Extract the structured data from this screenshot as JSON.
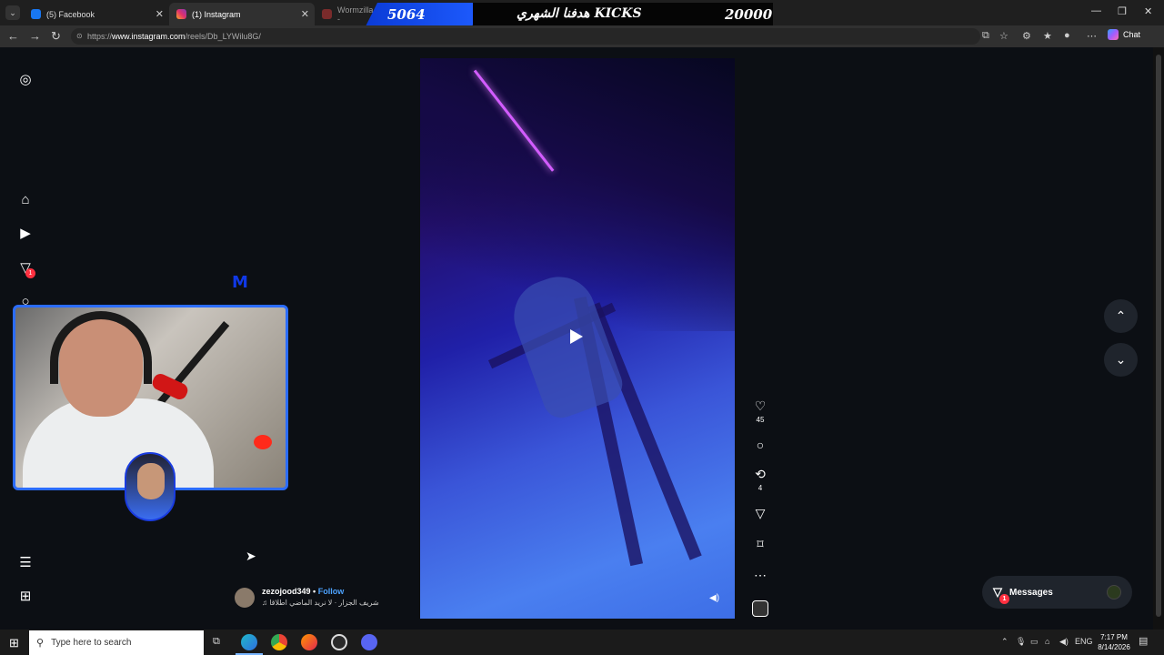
{
  "browser": {
    "tabs": [
      {
        "label": "(5) Facebook",
        "favicon": "facebook-icon",
        "color": "#1877f2"
      },
      {
        "label": "(1) Instagram",
        "favicon": "instagram-icon",
        "color": "#e1306c",
        "active": true
      },
      {
        "label": "Wormzilla.io -",
        "favicon": "wormzilla-icon",
        "color": "#7a2b2b"
      }
    ],
    "url_prefix": "https://",
    "url_host": "www.instagram.com",
    "url_path": "/reels/Db_LYWilu8G/",
    "chat_label": "Chat"
  },
  "stream_overlay": {
    "left_number": "5064",
    "title": "هدفنا الشهري KICKS",
    "right_number": "20000",
    "logo_letter": "M"
  },
  "sidebar": {
    "items": [
      {
        "name": "instagram-logo-icon",
        "glyph": "◎"
      },
      {
        "name": "home-icon",
        "glyph": "⌂"
      },
      {
        "name": "reels-icon",
        "glyph": "▶"
      },
      {
        "name": "direct-icon",
        "glyph": "▽",
        "badge": "1"
      },
      {
        "name": "search-icon",
        "glyph": "○"
      },
      {
        "name": "menu-icon",
        "glyph": "☰"
      },
      {
        "name": "meta-icon",
        "glyph": "⊞"
      }
    ]
  },
  "reel": {
    "likes": "45",
    "reposts": "4",
    "author": "zezojood349",
    "separator": "•",
    "follow_label": "Follow",
    "audio": "شريف الجزار · لا نريد الماضي اطلاقا"
  },
  "messages": {
    "label": "Messages",
    "badge": "1"
  },
  "taskbar": {
    "search_placeholder": "Type here to search",
    "language": "ENG",
    "time": "7:17 PM",
    "date": "8/14/2026"
  },
  "colors": {
    "accent_blue": "#2b6cff",
    "link_blue": "#4da3ff",
    "badge_red": "#ff3040"
  }
}
